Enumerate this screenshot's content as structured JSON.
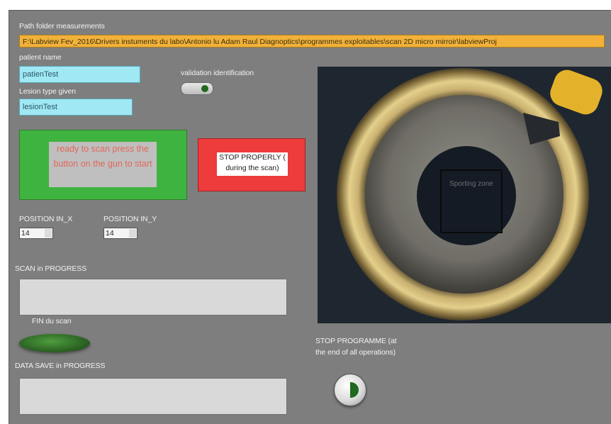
{
  "path": {
    "label": "Path folder measurements",
    "value": "F:\\Labview Fev_2016\\Drivers instuments du labo\\Antonio lu Adam Raul Diagnoptics\\programmes exploitables\\scan 2D micro mirroir\\labviewProj"
  },
  "patient": {
    "label": "patient name",
    "value": "patienTest"
  },
  "lesion": {
    "label": "Lesion type given",
    "value": "lesionTest"
  },
  "validation": {
    "label": "validation identification"
  },
  "ready_button": {
    "label": "ready to scan press the button on the gun to start"
  },
  "stop_properly": {
    "label": "STOP PROPERLY ( during the scan)"
  },
  "position_x": {
    "label": "POSITION IN_X",
    "value": "14"
  },
  "position_y": {
    "label": "POSITION IN_Y",
    "value": "14"
  },
  "scan_progress": {
    "label": "SCAN in PROGRESS"
  },
  "fin_scan": {
    "label": "FIN du scan"
  },
  "data_save": {
    "label": "DATA SAVE in PROGRESS"
  },
  "stop_programme": {
    "label": "STOP PROGRAMME (at the end of all operations)"
  },
  "camera": {
    "overlay_text": "Sporting zone"
  },
  "colors": {
    "panel": "#7e7e7e",
    "path_field": "#f2b23a",
    "cyan_field": "#9fe8f4",
    "ready_green": "#3fb33f",
    "stop_red": "#ee3b3b",
    "led_green": "#2f6a26"
  }
}
